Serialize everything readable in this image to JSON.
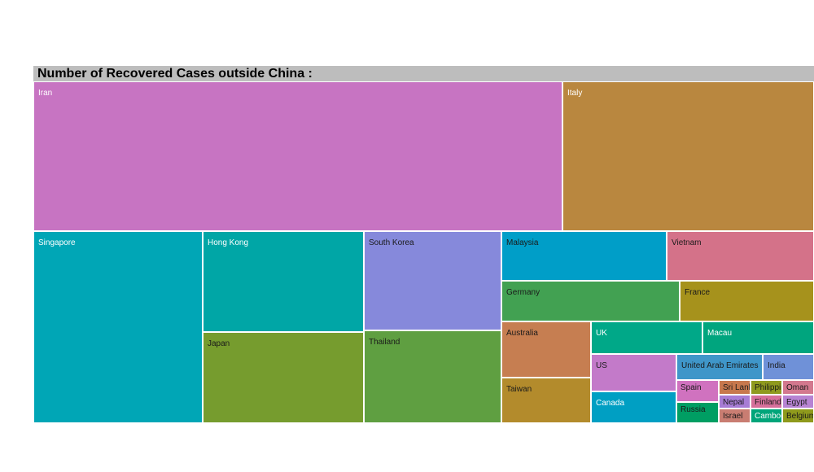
{
  "chart_data": {
    "type": "treemap",
    "title": "Number of Recovered Cases outside China :",
    "items": [
      {
        "label": "Iran",
        "color": "#c774c2",
        "text_color": "light"
      },
      {
        "label": "Italy",
        "color": "#b9873f",
        "text_color": "light"
      },
      {
        "label": "Singapore",
        "color": "#00a6b6",
        "text_color": "light"
      },
      {
        "label": "Hong Kong",
        "color": "#00a6a6",
        "text_color": "light"
      },
      {
        "label": "Japan",
        "color": "#769c2e",
        "text_color": "dark"
      },
      {
        "label": "South Korea",
        "color": "#8689db",
        "text_color": "dark"
      },
      {
        "label": "Thailand",
        "color": "#5f9f41",
        "text_color": "dark"
      },
      {
        "label": "Malaysia",
        "color": "#009ec8",
        "text_color": "dark"
      },
      {
        "label": "Vietnam",
        "color": "#d47289",
        "text_color": "dark"
      },
      {
        "label": "Germany",
        "color": "#42a152",
        "text_color": "dark"
      },
      {
        "label": "France",
        "color": "#a6921c",
        "text_color": "dark"
      },
      {
        "label": "Australia",
        "color": "#c67e51",
        "text_color": "dark"
      },
      {
        "label": "UK",
        "color": "#00a888",
        "text_color": "light"
      },
      {
        "label": "Macau",
        "color": "#00a57e",
        "text_color": "light"
      },
      {
        "label": "Taiwan",
        "color": "#b38b2c",
        "text_color": "dark"
      },
      {
        "label": "US",
        "color": "#c37ac9",
        "text_color": "dark"
      },
      {
        "label": "Canada",
        "color": "#009fc3",
        "text_color": "light"
      },
      {
        "label": "United Arab Emirates",
        "color": "#3f96c9",
        "text_color": "dark"
      },
      {
        "label": "India",
        "color": "#6f91d8",
        "text_color": "dark"
      },
      {
        "label": "Spain",
        "color": "#d072bf",
        "text_color": "dark"
      },
      {
        "label": "Russia",
        "color": "#009e63",
        "text_color": "dark"
      },
      {
        "label": "Sri Lanka",
        "color": "#c7784d",
        "text_color": "dark"
      },
      {
        "label": "Nepal",
        "color": "#a77cd5",
        "text_color": "dark"
      },
      {
        "label": "Israel",
        "color": "#c97d72",
        "text_color": "dark"
      },
      {
        "label": "Philippines",
        "color": "#8f9a1f",
        "text_color": "dark"
      },
      {
        "label": "Finland",
        "color": "#d56f9a",
        "text_color": "dark"
      },
      {
        "label": "Cambodia",
        "color": "#00a57a",
        "text_color": "light"
      },
      {
        "label": "Oman",
        "color": "#d3788e",
        "text_color": "dark"
      },
      {
        "label": "Egypt",
        "color": "#b783d3",
        "text_color": "dark"
      },
      {
        "label": "Belgium",
        "color": "#8f9a1c",
        "text_color": "dark"
      }
    ]
  }
}
